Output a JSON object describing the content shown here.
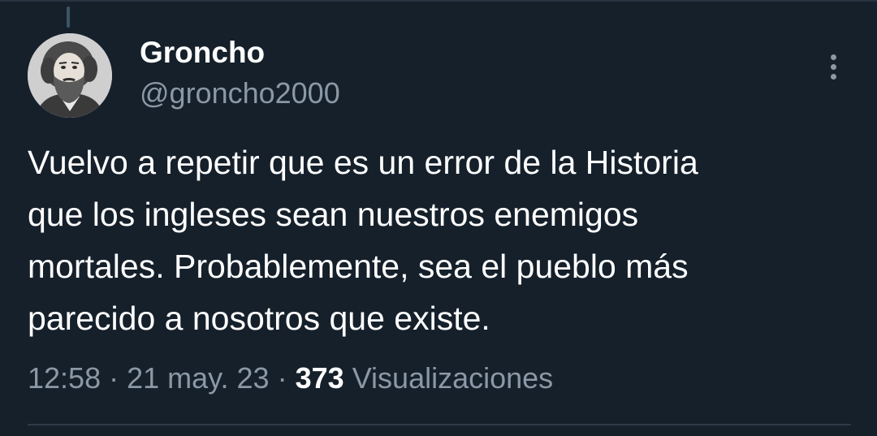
{
  "tweet": {
    "author": {
      "display_name": "Groncho",
      "handle": "@groncho2000",
      "avatar": "bearded-man-portrait"
    },
    "text_lines": [
      "Vuelvo a repetir que es un error de la Historia",
      "que los ingleses sean nuestros enemigos",
      "mortales. Probablemente, sea el pueblo más",
      "parecido a nosotros que existe."
    ],
    "time": "12:58",
    "date": "21 may. 23",
    "separator": "·",
    "views_count": "373",
    "views_label": "Visualizaciones",
    "more_icon": "vertical-ellipsis-icon"
  },
  "colors": {
    "background": "#15202b",
    "text_primary": "#ffffff",
    "text_secondary": "#8b98a5",
    "divider": "#2f3b47"
  }
}
